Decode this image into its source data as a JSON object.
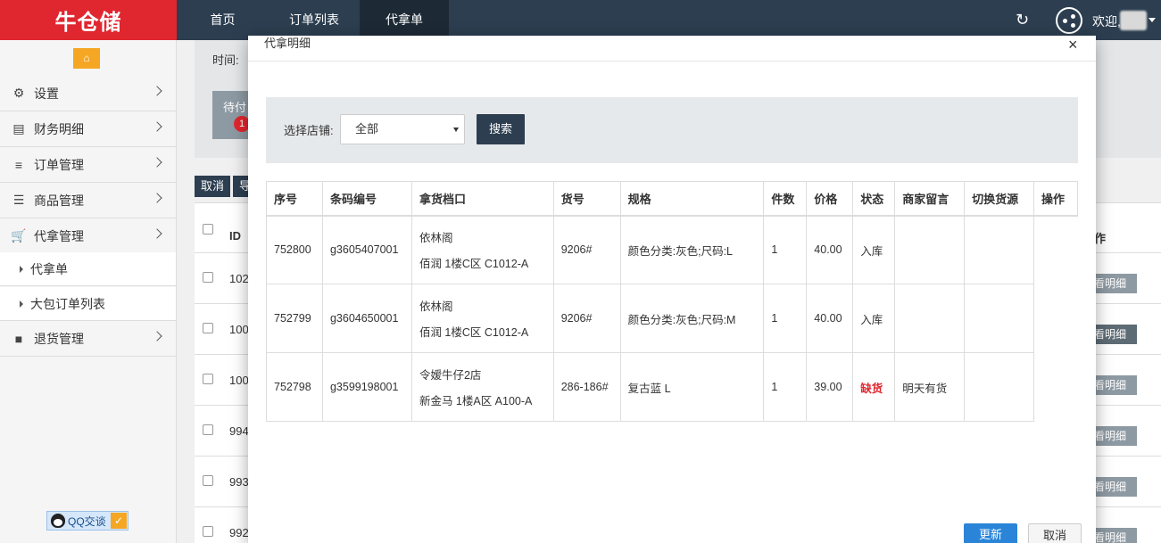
{
  "brand": {
    "logo_text": "牛仓储"
  },
  "topnav": {
    "items": [
      {
        "label": "首页"
      },
      {
        "label": "订单列表"
      },
      {
        "label": "代拿单"
      }
    ],
    "welcome": "欢迎,"
  },
  "sidebar": {
    "menu": [
      {
        "label": "设置",
        "icon": "gears-icon"
      },
      {
        "label": "财务明细",
        "icon": "briefcase-icon"
      },
      {
        "label": "订单管理",
        "icon": "bars-icon"
      },
      {
        "label": "商品管理",
        "icon": "list-icon"
      },
      {
        "label": "代拿管理",
        "icon": "cart-icon"
      },
      {
        "label": "退货管理",
        "icon": "truck-icon"
      }
    ],
    "sub": [
      {
        "label": "代拿单"
      },
      {
        "label": "大包订单列表"
      }
    ],
    "qq_label": "QQ交谈"
  },
  "background": {
    "time_label": "时间:",
    "pending_label": "待付",
    "pending_count": "1",
    "cancel_label": "取消",
    "btn2_label": "导",
    "id_header": "ID",
    "op_header": "作",
    "ids": [
      "102",
      "100",
      "100",
      "994",
      "993",
      "992"
    ],
    "op_label": "看明细"
  },
  "modal": {
    "title": "代拿明细",
    "close": "×",
    "filter": {
      "label": "选择店铺:",
      "selected": "全部",
      "search": "搜索"
    },
    "columns": [
      "序号",
      "条码编号",
      "拿货档口",
      "货号",
      "规格",
      "件数",
      "价格",
      "状态",
      "商家留言",
      "切换货源",
      "操作"
    ],
    "rows": [
      {
        "no": "752800",
        "barcode": "g3605407001",
        "stall": "依林阁",
        "stall_addr": "佰润 1楼C区 C1012-A",
        "item": "9206#",
        "spec": "颜色分类:灰色;尺码:L",
        "qty": "1",
        "price": "40.00",
        "status": "入库",
        "note": ""
      },
      {
        "no": "752799",
        "barcode": "g3604650001",
        "stall": "依林阁",
        "stall_addr": "佰润 1楼C区 C1012-A",
        "item": "9206#",
        "spec": "颜色分类:灰色;尺码:M",
        "qty": "1",
        "price": "40.00",
        "status": "入库",
        "note": ""
      },
      {
        "no": "752798",
        "barcode": "g3599198001",
        "stall": "令嫒牛仔2店",
        "stall_addr": "新金马 1楼A区 A100-A",
        "item": "286-186#",
        "spec": "复古蓝 L",
        "qty": "1",
        "price": "39.00",
        "status": "缺货",
        "note": "明天有货"
      }
    ],
    "update": "更新",
    "cancel": "取消"
  },
  "colors": {
    "brand_red": "#e0262f",
    "nav_dark": "#2c3e50",
    "accent_blue": "#2a85d8",
    "status_missing": "#e0262f"
  }
}
